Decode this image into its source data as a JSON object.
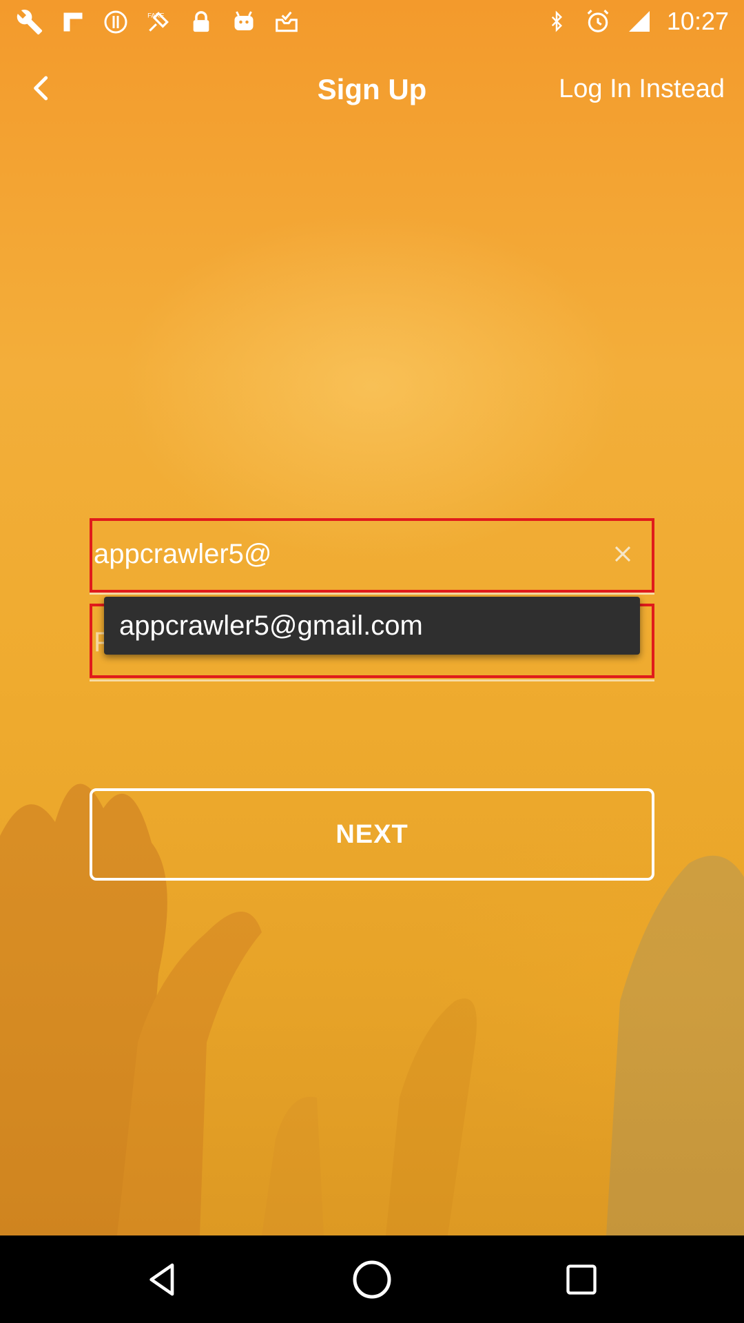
{
  "status_bar": {
    "time": "10:27",
    "left_icons": [
      "wrench-icon",
      "flipboard-icon",
      "alert-circle-icon",
      "fake-gps-icon",
      "lock-icon",
      "android-icon",
      "inbox-check-icon"
    ],
    "right_icons": [
      "bluetooth-icon",
      "alarm-icon",
      "signal-icon"
    ]
  },
  "app_bar": {
    "title": "Sign Up",
    "login_link": "Log In Instead"
  },
  "form": {
    "email_value": "appcrawler5@",
    "password_placeholder": "P",
    "suggestion": "appcrawler5@gmail.com",
    "next_label": "NEXT"
  },
  "colors": {
    "background": "#f0a630",
    "highlight_border": "#e01b1b",
    "suggestion_bg": "#2f2f2f"
  }
}
